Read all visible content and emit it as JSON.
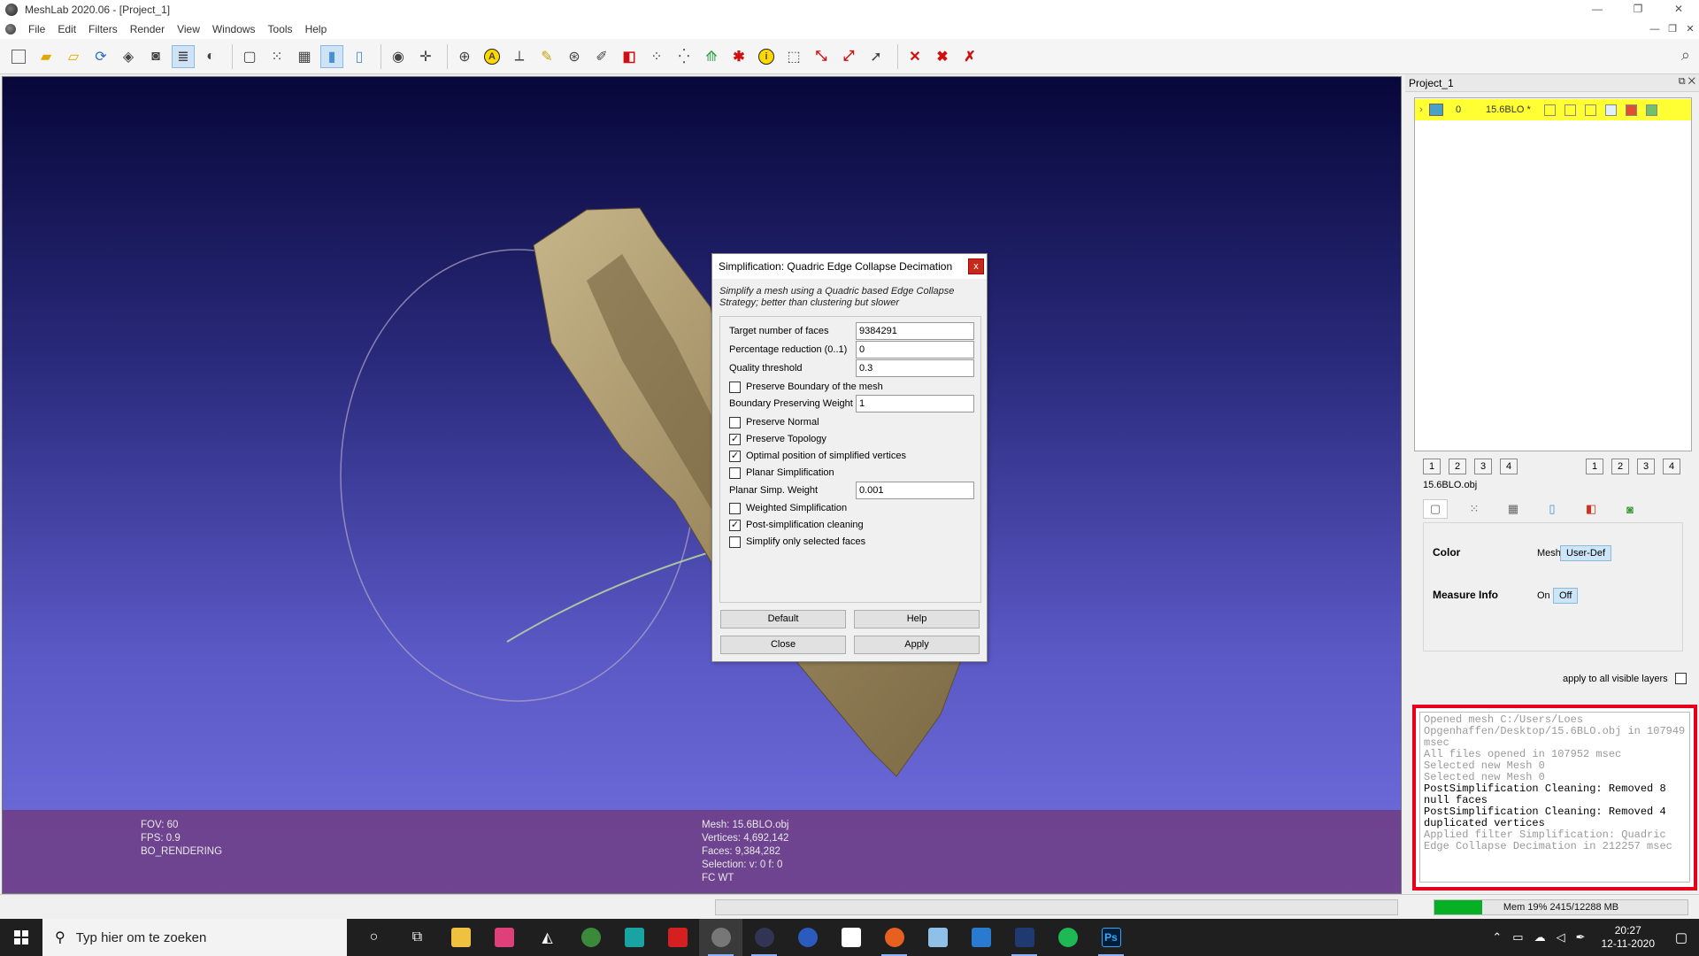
{
  "window": {
    "title": "MeshLab 2020.06 - [Project_1]",
    "controls": [
      "—",
      "❐",
      "✕"
    ]
  },
  "menu": {
    "items": [
      "File",
      "Edit",
      "Filters",
      "Render",
      "View",
      "Windows",
      "Tools",
      "Help"
    ],
    "mdi_controls": [
      "—",
      "❐",
      "✕"
    ]
  },
  "viewport": {
    "info_left": [
      "FOV: 60",
      "FPS:     0.9",
      "BO_RENDERING"
    ],
    "info_center": [
      "Mesh: 15.6BLO.obj",
      "Vertices: 4,692,142",
      "Faces: 9,384,282",
      "Selection: v: 0 f: 0",
      "FC WT"
    ]
  },
  "dialog": {
    "title": "Simplification: Quadric Edge Collapse Decimation",
    "close": "x",
    "description": "Simplify a mesh using a Quadric based Edge Collapse Strategy; better than clustering but slower",
    "fields": {
      "target_faces": {
        "label": "Target number of faces",
        "value": "9384291"
      },
      "percentage": {
        "label": "Percentage reduction (0..1)",
        "value": "0"
      },
      "quality": {
        "label": "Quality threshold",
        "value": "0.3"
      },
      "boundary_weight": {
        "label": "Boundary Preserving Weight",
        "value": "1"
      },
      "planar_weight": {
        "label": "Planar Simp. Weight",
        "value": "0.001"
      }
    },
    "checks": {
      "preserve_boundary": {
        "label": "Preserve Boundary of the mesh",
        "checked": false,
        "mark": ""
      },
      "preserve_normal": {
        "label": "Preserve Normal",
        "checked": false,
        "mark": ""
      },
      "preserve_topology": {
        "label": "Preserve Topology",
        "checked": true,
        "mark": "✓"
      },
      "optimal_position": {
        "label": "Optimal position of simplified vertices",
        "checked": true,
        "mark": "✓"
      },
      "planar_simplification": {
        "label": "Planar Simplification",
        "checked": false,
        "mark": ""
      },
      "weighted_simplification": {
        "label": "Weighted Simplification",
        "checked": false,
        "mark": ""
      },
      "post_cleaning": {
        "label": "Post-simplification cleaning",
        "checked": true,
        "mark": "✓"
      },
      "only_selected": {
        "label": "Simplify only selected faces",
        "checked": false,
        "mark": ""
      }
    },
    "buttons": {
      "default": "Default",
      "help": "Help",
      "close": "Close",
      "apply": "Apply"
    }
  },
  "right_panel": {
    "title": "Project_1",
    "head_controls": "⧉ ✕",
    "layer": {
      "number": "0",
      "name": "15.6BLO *"
    },
    "view_buttons_left": [
      "1",
      "2",
      "3",
      "4"
    ],
    "view_buttons_right": [
      "1",
      "2",
      "3",
      "4"
    ],
    "object_name": "15.6BLO.obj",
    "color": {
      "label": "Color",
      "option": "Mesh",
      "button": "User-Def"
    },
    "measure": {
      "label": "Measure Info",
      "on": "On",
      "off": "Off"
    },
    "apply_all": "apply to all visible layers",
    "log": [
      "Opened mesh C:/Users/Loes Opgenhaffen/Desktop/15.6BLO.obj in 107949 msec",
      "All files opened in 107952 msec",
      "Selected new Mesh 0",
      "Selected new Mesh 0",
      "PostSimplification Cleaning: Removed 8 null faces",
      "PostSimplification Cleaning: Removed 4 duplicated vertices",
      "Applied filter Simplification: Quadric Edge Collapse Decimation in 212257 msec"
    ]
  },
  "status": {
    "memory_text": "Mem 19% 2415/12288 MB",
    "memory_percent": 19
  },
  "taskbar": {
    "search_placeholder": "Typ hier om te zoeken",
    "ps_label": "Ps",
    "time": "20:27",
    "date": "12-11-2020"
  },
  "colors": {
    "log_border": "#e8001a",
    "layer_highlight": "#ffff33",
    "info_bar": "#6e3c82",
    "mesh": "#a8946a"
  }
}
